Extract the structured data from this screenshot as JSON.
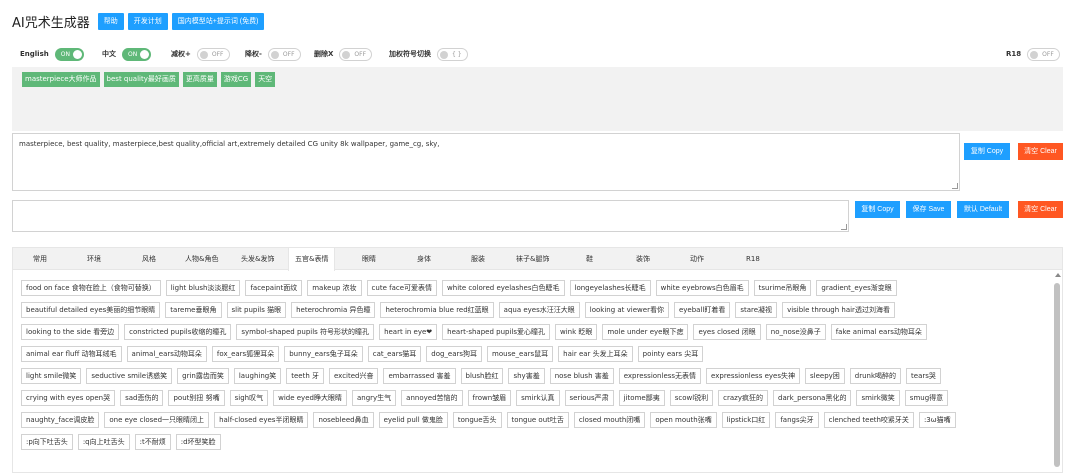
{
  "header": {
    "title": "AI咒术生成器",
    "buttons": [
      "帮助",
      "开发计划",
      "国内模型站+提示词 (免费)"
    ]
  },
  "toggles": [
    {
      "label": "English",
      "state": "ON"
    },
    {
      "label": "中文",
      "state": "ON"
    },
    {
      "label": "减权+",
      "state": "OFF"
    },
    {
      "label": "降权-",
      "state": "OFF"
    },
    {
      "label": "删除X",
      "state": "OFF"
    },
    {
      "label": "加权符号切换",
      "state": "{ }"
    },
    {
      "label": "R18",
      "state": "OFF"
    }
  ],
  "selected_tags": [
    "masterpiece大师作品",
    "best quality最好画质",
    "更高质量",
    "游戏CG",
    "天空"
  ],
  "prompt_text": "masterpiece, best quality, masterpiece,best quality,official art,extremely detailed CG unity 8k wallpaper, game_cg, sky,",
  "negative_text": "",
  "buttons": {
    "copy": "复制 Copy",
    "clear": "清空 Clear",
    "save": "保存 Save",
    "default": "默认 Default"
  },
  "tabs": [
    "常用",
    "环境",
    "风格",
    "人物&角色",
    "头发&发饰",
    "五官&表情",
    "眼睛",
    "身体",
    "服装",
    "袜子&腿饰",
    "鞋",
    "装饰",
    "动作",
    "R18"
  ],
  "active_tab": "五官&表情",
  "tag_rows": [
    [
      "food on face 食物在脸上（食物可替换）",
      "light blush淡淡腮红",
      "facepaint面纹",
      "makeup 浓妆",
      "cute face可爱表情",
      "white colored eyelashes白色睫毛",
      "longeyelashes长睫毛",
      "white eyebrows白色眉毛",
      "tsurime吊眼角",
      "gradient_eyes渐变眼"
    ],
    [
      "beautiful detailed eyes美丽的细节眼睛",
      "tareme垂眼角",
      "slit pupils 猫眼",
      "heterochromia 异色瞳",
      "heterochromia blue red红蓝眼",
      "aqua eyes水汪汪大眼",
      "looking at viewer看你",
      "eyeball盯着看",
      "stare凝视",
      "visible through hair透过刘海看"
    ],
    [
      "looking to the side 看旁边",
      "constricted pupils收缩的瞳孔",
      "symbol-shaped pupils 符号形状的瞳孔",
      "heart in eye❤",
      "heart-shaped pupils爱心瞳孔",
      "wink 眨眼",
      "mole under eye眼下痣",
      "eyes closed 闭眼",
      "no_nose没鼻子",
      "fake animal ears动物耳朵"
    ],
    [
      "animal ear fluff 动物耳绒毛",
      "animal_ears动物耳朵",
      "fox_ears狐狸耳朵",
      "bunny_ears兔子耳朵",
      "cat_ears猫耳",
      "dog_ears狗耳",
      "mouse_ears鼠耳",
      "hair ear 头发上耳朵",
      "pointy ears 尖耳"
    ],
    [
      "light smile微笑",
      "seductive smile诱惑笑",
      "grin露齿而笑",
      "laughing笑",
      "teeth 牙",
      "excited兴奋",
      "embarrassed 害羞",
      "blush脸红",
      "shy害羞",
      "nose blush 害羞",
      "expressionless无表情",
      "expressionless eyes失神",
      "sleepy困",
      "drunk喝醉的",
      "tears哭"
    ],
    [
      "crying with eyes open哭",
      "sad悲伤的",
      "pout别扭 努嘴",
      "sigh叹气",
      "wide eyed睁大眼睛",
      "angry生气",
      "annoyed苦恼的",
      "frown皱眉",
      "smirk认真",
      "serious严肃",
      "jitome鄙夷",
      "scowl锐利",
      "crazy疯狂的",
      "dark_persona黑化的",
      "smirk微笑",
      "smug得意"
    ],
    [
      "naughty_face调皮脸",
      "one eye closed一只眼睛闭上",
      "half-closed eyes半闭眼睛",
      "nosebleed鼻血",
      "eyelid pull 做鬼脸",
      "tongue舌头",
      "tongue out吐舌",
      "closed mouth闭嘴",
      "open mouth张嘴",
      "lipstick口红",
      "fangs尖牙",
      "clenched teeth咬紧牙关",
      ":3ω猫嘴"
    ],
    [
      ":p向下吐舌头",
      ":q向上吐舌头",
      ":t不耐烦",
      ":d坏型笑脸"
    ]
  ]
}
